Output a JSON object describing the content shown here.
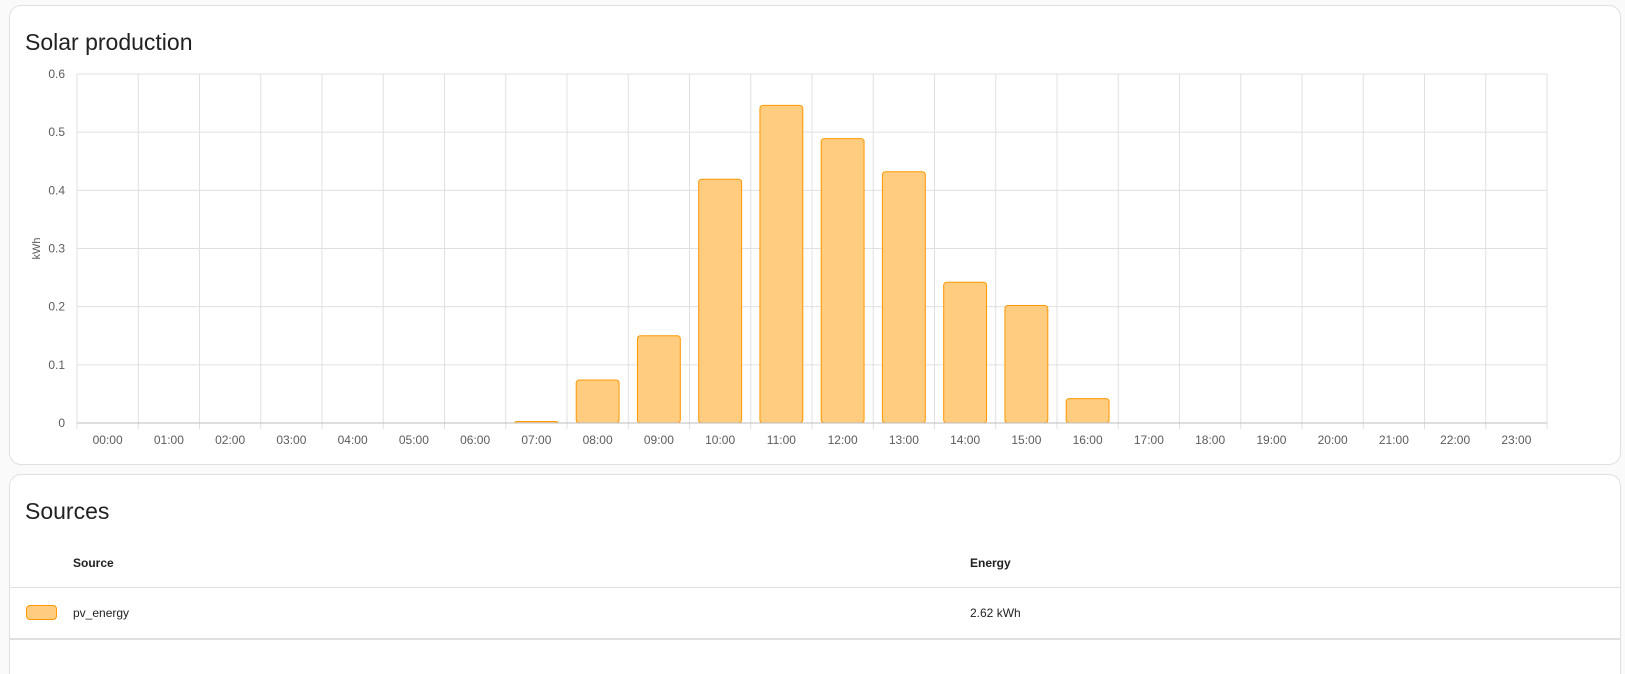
{
  "chart_card": {
    "title": "Solar production"
  },
  "colors": {
    "bar_fill": "#ffcc80",
    "bar_stroke": "#ff9800",
    "grid": "#e0e0e0",
    "axis": "#bdbdbd"
  },
  "chart_data": {
    "type": "bar",
    "title": "Solar production",
    "ylabel": "kWh",
    "xlabel": "",
    "ylim": [
      0,
      0.6
    ],
    "yticks": [
      "0",
      "0.1",
      "0.2",
      "0.3",
      "0.4",
      "0.5",
      "0.6"
    ],
    "grid": true,
    "categories": [
      "00:00",
      "01:00",
      "02:00",
      "03:00",
      "04:00",
      "05:00",
      "06:00",
      "07:00",
      "08:00",
      "09:00",
      "10:00",
      "11:00",
      "12:00",
      "13:00",
      "14:00",
      "15:00",
      "16:00",
      "17:00",
      "18:00",
      "19:00",
      "20:00",
      "21:00",
      "22:00",
      "23:00"
    ],
    "series": [
      {
        "name": "pv_energy",
        "values": [
          0,
          0,
          0,
          0,
          0,
          0,
          0,
          0.002,
          0.074,
          0.15,
          0.419,
          0.546,
          0.489,
          0.432,
          0.242,
          0.202,
          0.042,
          0,
          0,
          0,
          0,
          0,
          0,
          0
        ]
      }
    ]
  },
  "sources_card": {
    "title": "Sources",
    "headers": {
      "source": "Source",
      "energy": "Energy"
    },
    "rows": [
      {
        "name": "pv_energy",
        "energy": "2.62 kWh"
      }
    ]
  }
}
